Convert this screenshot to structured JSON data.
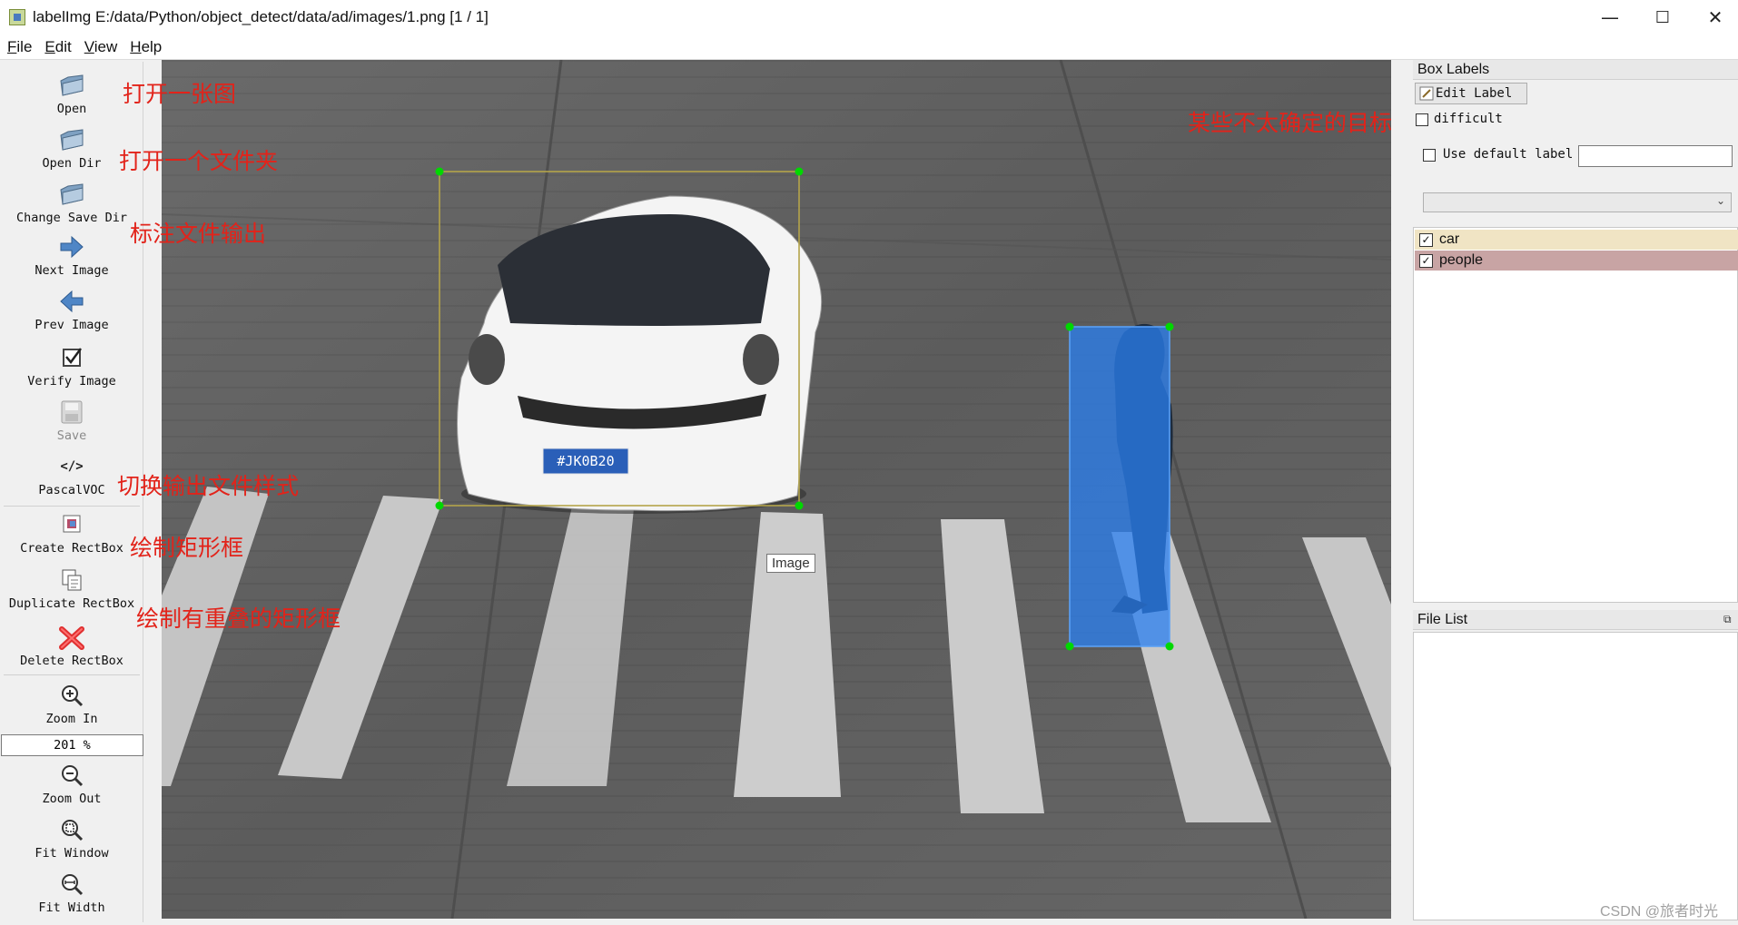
{
  "window": {
    "title": "labelImg E:/data/Python/object_detect/data/ad/images/1.png [1 / 1]",
    "minimize": "—",
    "maximize": "☐",
    "close": "✕"
  },
  "menu": [
    {
      "underline": "F",
      "rest": "ile"
    },
    {
      "underline": "E",
      "rest": "dit"
    },
    {
      "underline": "V",
      "rest": "iew"
    },
    {
      "underline": "H",
      "rest": "elp"
    }
  ],
  "toolbar": {
    "open": "Open",
    "open_dir": "Open Dir",
    "change_save_dir": "Change Save Dir",
    "next_image": "Next Image",
    "prev_image": "Prev Image",
    "verify_image": "Verify Image",
    "save": "Save",
    "format_icon": "</>",
    "format": "PascalVOC",
    "create_rectbox": "Create RectBox",
    "duplicate_rectbox": "Duplicate RectBox",
    "delete_rectbox": "Delete RectBox",
    "zoom_in": "Zoom In",
    "zoom_value": "201 %",
    "zoom_out": "Zoom Out",
    "fit_window": "Fit Window",
    "fit_width": "Fit Width"
  },
  "annotations": {
    "open": "打开一张图",
    "open_dir": "打开一个文件夹",
    "save_dir": "标注文件输出",
    "format": "切换输出文件样式",
    "create": "绘制矩形框",
    "duplicate": "绘制有重叠的矩形框",
    "difficult": "某些不太确定的目标"
  },
  "canvas": {
    "plate": "JK0B20",
    "plate_prefix": "#",
    "tooltip": "Image"
  },
  "box_labels": {
    "title": "Box Labels",
    "edit_label": "Edit Label",
    "difficult": "difficult",
    "use_default_label": "Use default label",
    "default_label_value": "",
    "labels": [
      {
        "name": "car",
        "checked": true,
        "color": "#f0e4c4"
      },
      {
        "name": "people",
        "checked": true,
        "color": "#c8a4a4"
      }
    ]
  },
  "file_list": {
    "title": "File List"
  },
  "watermark": "CSDN @旅者时光"
}
